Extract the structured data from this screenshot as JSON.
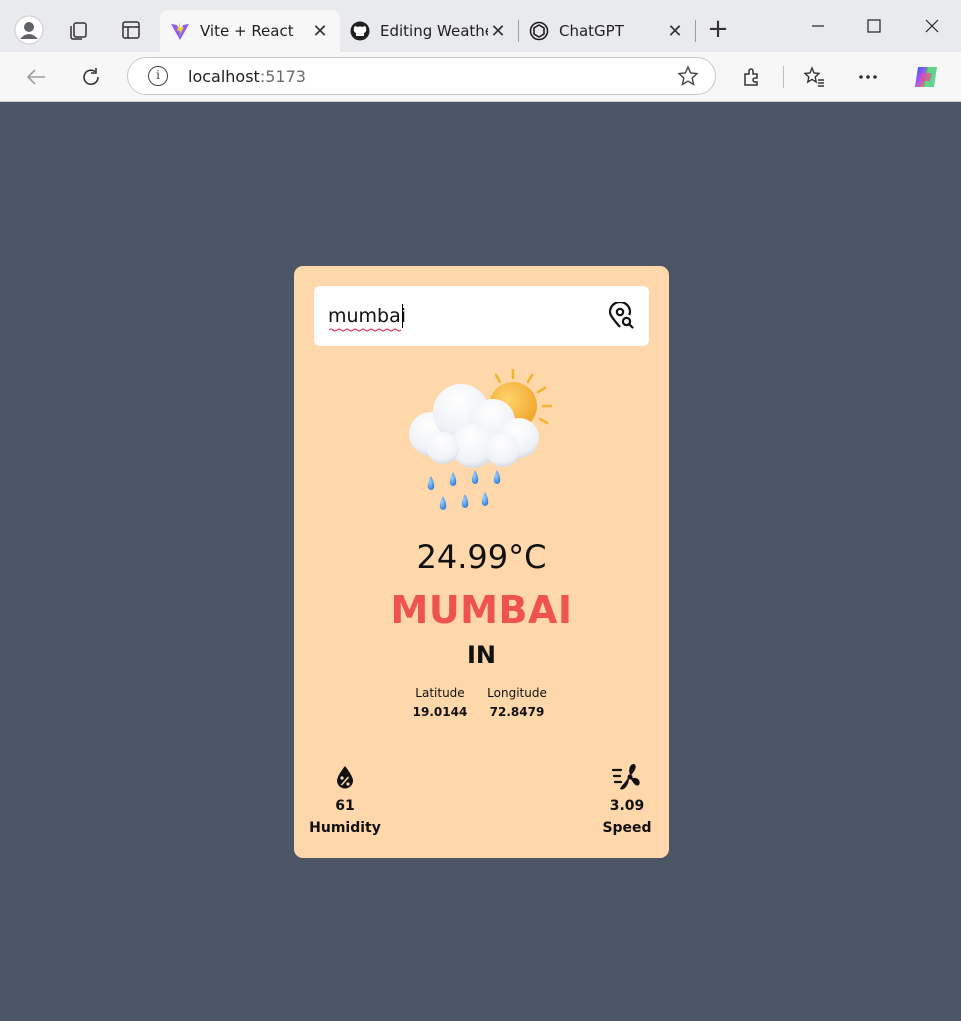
{
  "browser": {
    "tabs": [
      {
        "title": "Vite + React",
        "active": true
      },
      {
        "title": "Editing Weather",
        "active": false
      },
      {
        "title": "ChatGPT",
        "active": false
      }
    ],
    "address": {
      "host": "localhost",
      "port": ":5173"
    },
    "icons": [
      "profile-icon",
      "workspaces-icon",
      "tab-actions-icon",
      "back-icon",
      "refresh-icon",
      "site-info-icon",
      "favorite-star-icon",
      "extensions-icon",
      "favorites-icon",
      "more-icon",
      "copilot-icon"
    ]
  },
  "search": {
    "value": "mumbai",
    "icon": "location-search-icon"
  },
  "weather": {
    "icon": "sun-behind-rain-cloud",
    "temperature": "24.99°C",
    "city": "MUMBAI",
    "country": "IN",
    "latitude_label": "Latitude",
    "latitude": "19.0144",
    "longitude_label": "Longitude",
    "longitude": "72.8479",
    "humidity_value": "61",
    "humidity_label": "Humidity",
    "wind_value": "3.09",
    "wind_label": "Speed"
  },
  "colors": {
    "page_background": "#4b5563",
    "card_background": "#fed7aa",
    "city": "#ef5350"
  }
}
